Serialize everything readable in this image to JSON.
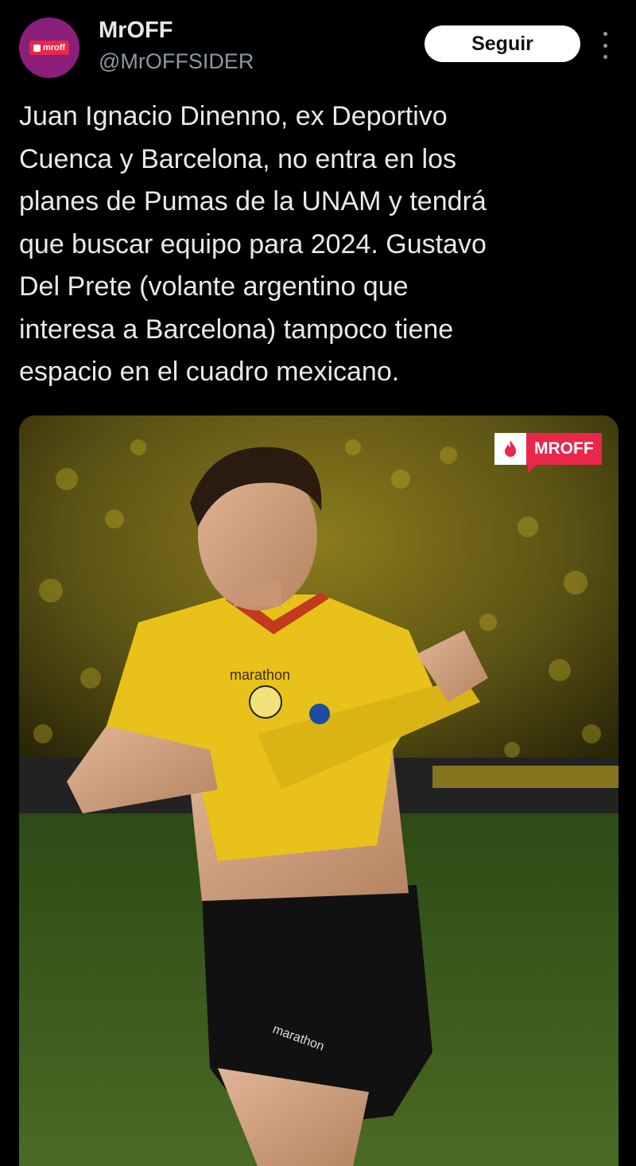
{
  "tweet": {
    "display_name": "MrOFF",
    "handle": "@MrOFFSIDER",
    "avatar_logo_text": "mroff",
    "follow_label": "Seguir",
    "text": "Juan Ignacio Dinenno, ex Deportivo\nCuenca y Barcelona, no entra en los\nplanes de Pumas de la UNAM y tendrá\nque buscar equipo para 2024. Gustavo\nDel Prete (volante argentino que\ninteresa a Barcelona) tampoco tiene\nespacio en el cuadro mexicano."
  },
  "media": {
    "watermark_text": "MROFF",
    "jersey_sponsor": "marathon",
    "colors": {
      "jersey": "#e8c21a",
      "shorts": "#111111",
      "crowd": "#6e6418",
      "pitch": "#3c5a1c",
      "brand": "#e8274b"
    }
  },
  "icons": {
    "more": "more-vertical-icon",
    "watermark": "flame-icon"
  }
}
